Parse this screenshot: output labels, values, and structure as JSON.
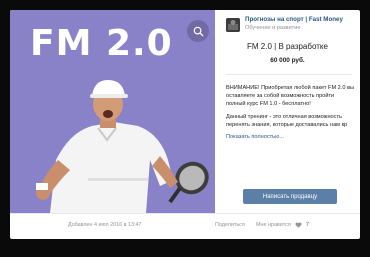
{
  "photo": {
    "title": "FM 2.0",
    "background": "#8a82c8",
    "zoom_icon": "magnifier-icon"
  },
  "group": {
    "name": "Прогнозы на спорт | Fast Money",
    "category": "Обучение и развитие"
  },
  "product": {
    "title": "FM 2.0 | В разработке",
    "price": "60 000 руб.",
    "description": [
      "ВНИМАНИЕ! Приобретая любой пакет FM 2.0 вы оставляете за собой возможность пройти полный курс FM 1.0 - бесплатно!",
      "Данный тренинг - это отличная возможность перенять знания, которые доставались нам кр"
    ],
    "more_link": "Показать полностью...",
    "contact_button": "Написать продавцу"
  },
  "footer": {
    "date": "Добавлен 4 июл 2016 в 13:47",
    "share": "Поделиться",
    "likes_label": "Мне нравится",
    "likes_count": "7"
  },
  "colors": {
    "accent": "#5b7fa6",
    "link": "#2a5885"
  }
}
